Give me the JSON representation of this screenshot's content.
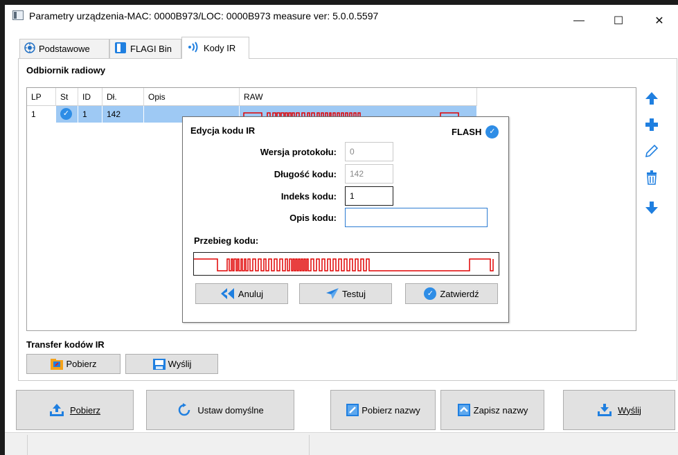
{
  "window": {
    "title": "Parametry urządzenia-MAC: 0000B973/LOC: 0000B973 measure ver: 5.0.0.5597",
    "minimize_glyph": "—",
    "maximize_glyph": "☐",
    "close_glyph": "✕"
  },
  "tabs": [
    {
      "label": "Podstawowe",
      "icon": "target-icon",
      "active": false
    },
    {
      "label": "FLAGI Bin",
      "icon": "flag-bin-icon",
      "active": false
    },
    {
      "label": "Kody IR",
      "icon": "infrared-icon",
      "active": true
    }
  ],
  "receiver": {
    "section_title": "Odbiornik radiowy",
    "columns": [
      "LP",
      "St",
      "ID",
      "Dł.",
      "Opis",
      "RAW"
    ],
    "rows": [
      {
        "lp": "1",
        "st": "✓",
        "id": "1",
        "dl": "142",
        "opis": "",
        "raw": ""
      }
    ]
  },
  "side_toolbar": [
    "move-up-icon",
    "add-icon",
    "edit-icon",
    "delete-icon",
    "move-down-icon"
  ],
  "transfer": {
    "title": "Transfer kodów IR",
    "download_label": "Pobierz",
    "upload_label": "Wyślij"
  },
  "dialog": {
    "title": "Edycja kodu IR",
    "flash_label": "FLASH",
    "protocol_label": "Wersja protokołu:",
    "protocol_value": "0",
    "length_label": "Długość kodu:",
    "length_value": "142",
    "index_label": "Indeks kodu:",
    "index_value": "1",
    "desc_label": "Opis kodu:",
    "desc_value": "",
    "waveform_label": "Przebieg kodu:",
    "cancel_label": "Anuluj",
    "test_label": "Testuj",
    "confirm_label": "Zatwierdź"
  },
  "bottom": {
    "pobierz": "Pobierz",
    "ustaw_domyslne": "Ustaw domyślne",
    "pobierz_nazwy": "Pobierz nazwy",
    "zapisz_nazwy": "Zapisz nazwy",
    "wyslij": "Wyślij"
  },
  "colors": {
    "accent_blue": "#2e8de6",
    "selection": "#9ec9f4",
    "waveform_red": "#e00000"
  }
}
